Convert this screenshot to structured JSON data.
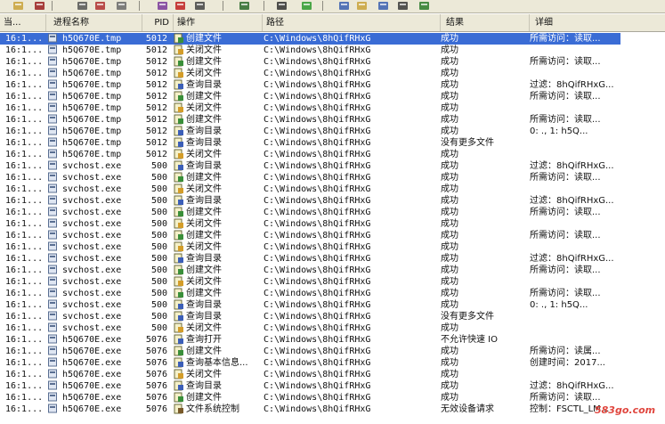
{
  "toolbar": {
    "icons": [
      "open-icon",
      "save-icon",
      "find-icon",
      "highlight-icon",
      "edit-filter-icon",
      "filter-icon",
      "capture-icon",
      "network-icon",
      "jump-icon",
      "tree-icon",
      "refresh-icon",
      "registry-icon",
      "file-icon",
      "network-activity-icon",
      "process-icon",
      "profiling-icon"
    ]
  },
  "columns": {
    "time": "当...",
    "process": "进程名称",
    "pid": "PID",
    "operation": "操作",
    "path": "路径",
    "result": "结果",
    "detail": "详细"
  },
  "colors": {
    "selection": "#3a6cd5",
    "create_icon": "#3a8f3a",
    "query_icon": "#3c5fb8",
    "close_icon": "#d49d2a"
  },
  "rows": [
    {
      "time": "16:1...",
      "process": "h5Q670E.tmp",
      "pid": "5012",
      "op": "创建文件",
      "path": "C:\\Windows\\8hQifRHxG",
      "result": "成功",
      "detail": "所需访问：读取...",
      "kind": "create",
      "selected": true
    },
    {
      "time": "16:1...",
      "process": "h5Q670E.tmp",
      "pid": "5012",
      "op": "关闭文件",
      "path": "C:\\Windows\\8hQifRHxG",
      "result": "成功",
      "detail": "",
      "kind": "close"
    },
    {
      "time": "16:1...",
      "process": "h5Q670E.tmp",
      "pid": "5012",
      "op": "创建文件",
      "path": "C:\\Windows\\8hQifRHxG",
      "result": "成功",
      "detail": "所需访问：读取...",
      "kind": "create"
    },
    {
      "time": "16:1...",
      "process": "h5Q670E.tmp",
      "pid": "5012",
      "op": "关闭文件",
      "path": "C:\\Windows\\8hQifRHxG",
      "result": "成功",
      "detail": "",
      "kind": "close"
    },
    {
      "time": "16:1...",
      "process": "h5Q670E.tmp",
      "pid": "5012",
      "op": "查询目录",
      "path": "C:\\Windows\\8hQifRHxG",
      "result": "成功",
      "detail": "过滤：8hQifRHxG...",
      "kind": "query"
    },
    {
      "time": "16:1...",
      "process": "h5Q670E.tmp",
      "pid": "5012",
      "op": "创建文件",
      "path": "C:\\Windows\\8hQifRHxG",
      "result": "成功",
      "detail": "所需访问：读取...",
      "kind": "create"
    },
    {
      "time": "16:1...",
      "process": "h5Q670E.tmp",
      "pid": "5012",
      "op": "关闭文件",
      "path": "C:\\Windows\\8hQifRHxG",
      "result": "成功",
      "detail": "",
      "kind": "close"
    },
    {
      "time": "16:1...",
      "process": "h5Q670E.tmp",
      "pid": "5012",
      "op": "创建文件",
      "path": "C:\\Windows\\8hQifRHxG",
      "result": "成功",
      "detail": "所需访问：读取...",
      "kind": "create"
    },
    {
      "time": "16:1...",
      "process": "h5Q670E.tmp",
      "pid": "5012",
      "op": "查询目录",
      "path": "C:\\Windows\\8hQifRHxG",
      "result": "成功",
      "detail": "0: ., 1: h5Q...",
      "kind": "query"
    },
    {
      "time": "16:1...",
      "process": "h5Q670E.tmp",
      "pid": "5012",
      "op": "查询目录",
      "path": "C:\\Windows\\8hQifRHxG",
      "result": "没有更多文件",
      "detail": "",
      "kind": "query"
    },
    {
      "time": "16:1...",
      "process": "h5Q670E.tmp",
      "pid": "5012",
      "op": "关闭文件",
      "path": "C:\\Windows\\8hQifRHxG",
      "result": "成功",
      "detail": "",
      "kind": "close"
    },
    {
      "time": "16:1...",
      "process": "svchost.exe",
      "pid": "500",
      "op": "查询目录",
      "path": "C:\\Windows\\8hQifRHxG",
      "result": "成功",
      "detail": "过滤：8hQifRHxG...",
      "kind": "query"
    },
    {
      "time": "16:1...",
      "process": "svchost.exe",
      "pid": "500",
      "op": "创建文件",
      "path": "C:\\Windows\\8hQifRHxG",
      "result": "成功",
      "detail": "所需访问：读取...",
      "kind": "create"
    },
    {
      "time": "16:1...",
      "process": "svchost.exe",
      "pid": "500",
      "op": "关闭文件",
      "path": "C:\\Windows\\8hQifRHxG",
      "result": "成功",
      "detail": "",
      "kind": "close"
    },
    {
      "time": "16:1...",
      "process": "svchost.exe",
      "pid": "500",
      "op": "查询目录",
      "path": "C:\\Windows\\8hQifRHxG",
      "result": "成功",
      "detail": "过滤：8hQifRHxG...",
      "kind": "query"
    },
    {
      "time": "16:1...",
      "process": "svchost.exe",
      "pid": "500",
      "op": "创建文件",
      "path": "C:\\Windows\\8hQifRHxG",
      "result": "成功",
      "detail": "所需访问：读取...",
      "kind": "create"
    },
    {
      "time": "16:1...",
      "process": "svchost.exe",
      "pid": "500",
      "op": "关闭文件",
      "path": "C:\\Windows\\8hQifRHxG",
      "result": "成功",
      "detail": "",
      "kind": "close"
    },
    {
      "time": "16:1...",
      "process": "svchost.exe",
      "pid": "500",
      "op": "创建文件",
      "path": "C:\\Windows\\8hQifRHxG",
      "result": "成功",
      "detail": "所需访问：读取...",
      "kind": "create"
    },
    {
      "time": "16:1...",
      "process": "svchost.exe",
      "pid": "500",
      "op": "关闭文件",
      "path": "C:\\Windows\\8hQifRHxG",
      "result": "成功",
      "detail": "",
      "kind": "close"
    },
    {
      "time": "16:1...",
      "process": "svchost.exe",
      "pid": "500",
      "op": "查询目录",
      "path": "C:\\Windows\\8hQifRHxG",
      "result": "成功",
      "detail": "过滤：8hQifRHxG...",
      "kind": "query"
    },
    {
      "time": "16:1...",
      "process": "svchost.exe",
      "pid": "500",
      "op": "创建文件",
      "path": "C:\\Windows\\8hQifRHxG",
      "result": "成功",
      "detail": "所需访问：读取...",
      "kind": "create"
    },
    {
      "time": "16:1...",
      "process": "svchost.exe",
      "pid": "500",
      "op": "关闭文件",
      "path": "C:\\Windows\\8hQifRHxG",
      "result": "成功",
      "detail": "",
      "kind": "close"
    },
    {
      "time": "16:1...",
      "process": "svchost.exe",
      "pid": "500",
      "op": "创建文件",
      "path": "C:\\Windows\\8hQifRHxG",
      "result": "成功",
      "detail": "所需访问：读取...",
      "kind": "create"
    },
    {
      "time": "16:1...",
      "process": "svchost.exe",
      "pid": "500",
      "op": "查询目录",
      "path": "C:\\Windows\\8hQifRHxG",
      "result": "成功",
      "detail": "0: ., 1: h5Q...",
      "kind": "query"
    },
    {
      "time": "16:1...",
      "process": "svchost.exe",
      "pid": "500",
      "op": "查询目录",
      "path": "C:\\Windows\\8hQifRHxG",
      "result": "没有更多文件",
      "detail": "",
      "kind": "query"
    },
    {
      "time": "16:1...",
      "process": "svchost.exe",
      "pid": "500",
      "op": "关闭文件",
      "path": "C:\\Windows\\8hQifRHxG",
      "result": "成功",
      "detail": "",
      "kind": "close"
    },
    {
      "time": "16:1...",
      "process": "h5Q670E.exe",
      "pid": "5076",
      "op": "查询打开",
      "path": "C:\\Windows\\8hQifRHxG",
      "result": "不允许快速 IO",
      "detail": "",
      "kind": "query"
    },
    {
      "time": "16:1...",
      "process": "h5Q670E.exe",
      "pid": "5076",
      "op": "创建文件",
      "path": "C:\\Windows\\8hQifRHxG",
      "result": "成功",
      "detail": "所需访问：读属...",
      "kind": "create"
    },
    {
      "time": "16:1...",
      "process": "h5Q670E.exe",
      "pid": "5076",
      "op": "查询基本信息...",
      "path": "C:\\Windows\\8hQifRHxG",
      "result": "成功",
      "detail": "创建时间：2017...",
      "kind": "query"
    },
    {
      "time": "16:1...",
      "process": "h5Q670E.exe",
      "pid": "5076",
      "op": "关闭文件",
      "path": "C:\\Windows\\8hQifRHxG",
      "result": "成功",
      "detail": "",
      "kind": "close"
    },
    {
      "time": "16:1...",
      "process": "h5Q670E.exe",
      "pid": "5076",
      "op": "查询目录",
      "path": "C:\\Windows\\8hQifRHxG",
      "result": "成功",
      "detail": "过滤：8hQifRHxG...",
      "kind": "query"
    },
    {
      "time": "16:1...",
      "process": "h5Q670E.exe",
      "pid": "5076",
      "op": "创建文件",
      "path": "C:\\Windows\\8hQifRHxG",
      "result": "成功",
      "detail": "所需访问：读取...",
      "kind": "create"
    },
    {
      "time": "16:1...",
      "process": "h5Q670E.exe",
      "pid": "5076",
      "op": "文件系统控制",
      "path": "C:\\Windows\\8hQifRHxG",
      "result": "无效设备请求",
      "detail": "控制：FSCTL_LM...",
      "kind": "fsctl"
    }
  ],
  "watermark": "583go.com"
}
